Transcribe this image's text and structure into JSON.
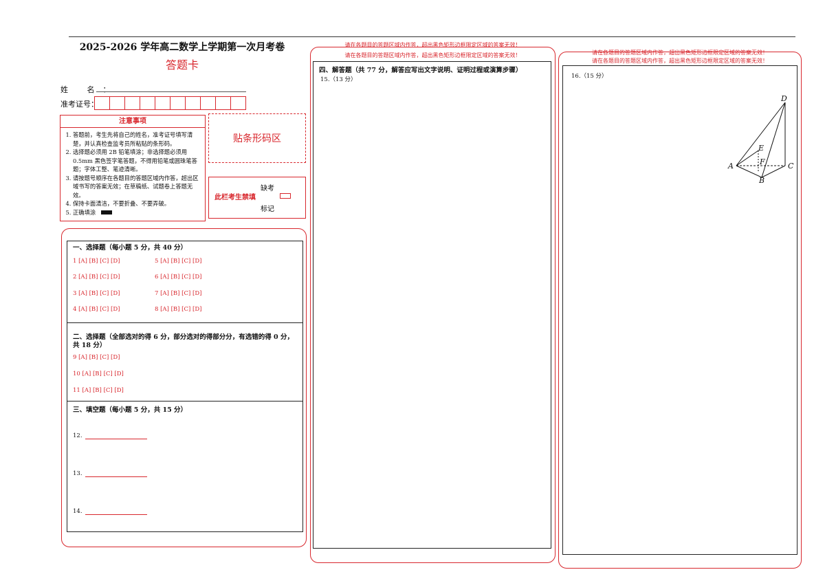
{
  "header": {
    "title": "2025-2026 学年高二数学上学期第一次月考卷",
    "subtitle": "答题卡"
  },
  "student": {
    "name_label": "姓 名：",
    "id_label": "准考证号："
  },
  "notice": {
    "heading": "注意事项",
    "items": [
      "答题前，考生先将自己的姓名，准考证号填写清楚，并认真检查监考员所粘贴的条形码。",
      "选择题必须用 2B 铅笔填涂；非选择题必须用 0.5mm 黑色签字笔答题，不得用铅笔或圆珠笔答题；字体工整、笔迹清晰。",
      "请按题号顺序在各题目的答题区域内作答，超出区域书写的答案无效；在草稿纸、试题卷上答题无效。",
      "保持卡面清洁，不要折叠、不要弄破。",
      "正确填涂"
    ]
  },
  "barcode_area": "贴条形码区",
  "absent": {
    "label": "此栏考生禁填",
    "mark_top": "缺考",
    "mark_bottom": "标记"
  },
  "section1": {
    "title": "一、选择题（每小题 5 分，共 40 分）",
    "options": [
      "1 [A] [B] [C] [D]",
      "5 [A] [B] [C] [D]",
      "2 [A] [B] [C] [D]",
      "6 [A] [B] [C] [D]",
      "3 [A] [B] [C] [D]",
      "7 [A] [B] [C] [D]",
      "4 [A] [B] [C] [D]",
      "8 [A] [B] [C] [D]"
    ]
  },
  "section2": {
    "title": "二、选择题（全部选对的得 6 分，部分选对的得部分分，有选错的得 0 分，共 18 分）",
    "options": [
      "9 [A] [B] [C] [D]",
      "10 [A] [B] [C] [D]",
      "11 [A] [B] [C] [D]"
    ]
  },
  "section3": {
    "title": "三、填空题（每小题 5 分，共 15 分）",
    "blanks": [
      "12.",
      "13.",
      "14."
    ]
  },
  "warning": "请在各题目的答题区域内作答，超出黑色矩形边框限定区域的答案无效！",
  "section4": {
    "title": "四、解答题（共 77 分，解答应写出文字说明、证明过程或演算步骤）",
    "q15": "15.（13 分）",
    "q16": "16.（15 分）"
  },
  "figure": {
    "labels": {
      "A": "A",
      "B": "B",
      "C": "C",
      "D": "D",
      "E": "E",
      "F": "F"
    }
  },
  "colors": {
    "accent": "#d8262c",
    "ink": "#111111"
  }
}
